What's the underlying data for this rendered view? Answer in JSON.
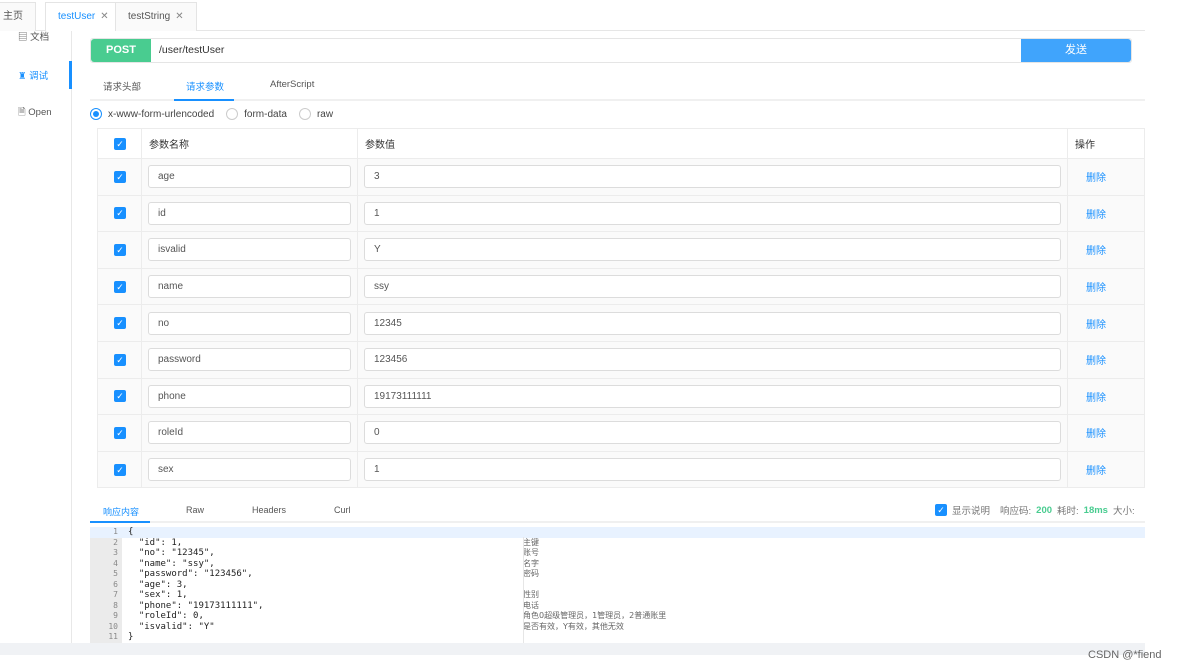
{
  "tabs": [
    {
      "label": "主页"
    },
    {
      "label": "testUser",
      "active": true
    },
    {
      "label": "testString"
    }
  ],
  "sidebar": {
    "items": [
      {
        "label": "文档",
        "icon": "document-icon"
      },
      {
        "label": "调试",
        "icon": "bug-icon",
        "active": true
      },
      {
        "label": "Open",
        "icon": "file-icon"
      }
    ]
  },
  "request": {
    "method": "POST",
    "url": "/user/testUser",
    "send_label": "发送"
  },
  "request_tabs": [
    "请求头部",
    "请求参数",
    "AfterScript"
  ],
  "body_types": [
    {
      "label": "x-www-form-urlencoded",
      "selected": true
    },
    {
      "label": "form-data"
    },
    {
      "label": "raw"
    }
  ],
  "params": {
    "headers": {
      "name": "参数名称",
      "value": "参数值",
      "action": "操作"
    },
    "rows": [
      {
        "name": "age",
        "value": "3"
      },
      {
        "name": "id",
        "value": "1"
      },
      {
        "name": "isvalid",
        "value": "Y"
      },
      {
        "name": "name",
        "value": "ssy"
      },
      {
        "name": "no",
        "value": "12345"
      },
      {
        "name": "password",
        "value": "123456"
      },
      {
        "name": "phone",
        "value": "19173111111"
      },
      {
        "name": "roleId",
        "value": "0"
      },
      {
        "name": "sex",
        "value": "1"
      }
    ],
    "delete_label": "删除"
  },
  "response": {
    "tabs": [
      "响应内容",
      "Raw",
      "Headers",
      "Curl"
    ],
    "show_desc_label": "显示说明",
    "code_label": "响应码:",
    "code": "200",
    "time_label": "耗时:",
    "time": "18ms",
    "size_label": "大小:",
    "lines": [
      {
        "n": "1",
        "code": "{",
        "comment": ""
      },
      {
        "n": "2",
        "code": "  \"id\": 1,",
        "comment": "主键"
      },
      {
        "n": "3",
        "code": "  \"no\": \"12345\",",
        "comment": "账号"
      },
      {
        "n": "4",
        "code": "  \"name\": \"ssy\",",
        "comment": "名字"
      },
      {
        "n": "5",
        "code": "  \"password\": \"123456\",",
        "comment": "密码"
      },
      {
        "n": "6",
        "code": "  \"age\": 3,",
        "comment": ""
      },
      {
        "n": "7",
        "code": "  \"sex\": 1,",
        "comment": "性别"
      },
      {
        "n": "8",
        "code": "  \"phone\": \"19173111111\",",
        "comment": "电话"
      },
      {
        "n": "9",
        "code": "  \"roleId\": 0,",
        "comment": "角色0超级管理员，1管理员，2普通账里"
      },
      {
        "n": "10",
        "code": "  \"isvalid\": \"Y\"",
        "comment": "是否有效，Y有效，其他无效"
      },
      {
        "n": "11",
        "code": "}",
        "comment": ""
      }
    ]
  },
  "watermark": "CSDN @*fiend"
}
